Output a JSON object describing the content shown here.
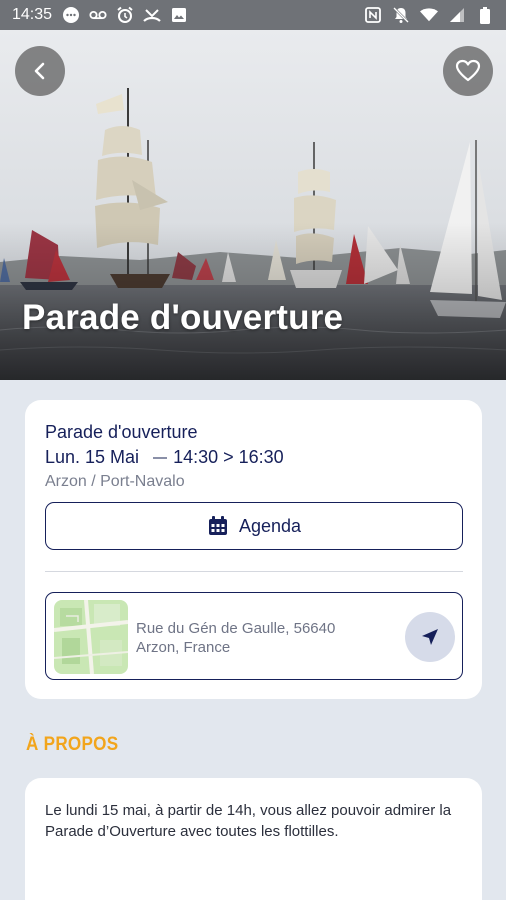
{
  "status_bar": {
    "time": "14:35",
    "left_icons": [
      "chat-bubble-icon",
      "voicemail-icon",
      "alarm-icon",
      "missed-call-icon",
      "image-icon"
    ],
    "right_icons": [
      "nfc-icon",
      "mute-icon",
      "wifi-icon",
      "signal-icon",
      "battery-icon"
    ]
  },
  "hero": {
    "title": "Parade d'ouverture"
  },
  "event": {
    "title": "Parade d'ouverture",
    "date": "Lun. 15 Mai",
    "time": "14:30 > 16:30",
    "place": "Arzon / Port-Navalo",
    "agenda_label": "Agenda",
    "address_line1": "Rue du Gén de Gaulle, 56640",
    "address_line2": "Arzon, France"
  },
  "about": {
    "section_title": "À PROPOS",
    "text": "Le lundi 15 mai, à partir de 14h, vous allez pouvoir admirer la Parade d’Ouverture avec toutes les flottilles."
  },
  "colors": {
    "navy": "#16205a",
    "accent": "#f2a51c",
    "background": "#e2e7ee"
  }
}
